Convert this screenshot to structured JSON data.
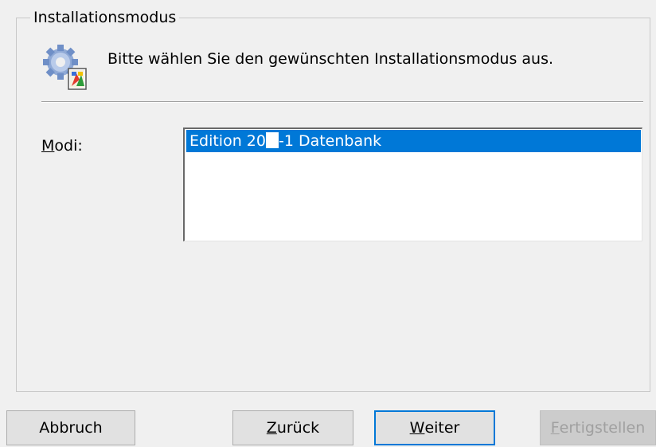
{
  "group": {
    "title": "Installationsmodus"
  },
  "header": {
    "icon": "setup-gear-icon",
    "text": "Bitte wählen Sie den gewünschten Installationsmodus aus."
  },
  "modi": {
    "label_accel": "M",
    "label_rest": "odi:",
    "items": [
      {
        "text_before": "Edition 20",
        "text_after": "-1 Datenbank",
        "selected": true
      }
    ]
  },
  "buttons": {
    "cancel": {
      "label": "Abbruch"
    },
    "back": {
      "accel": "Z",
      "rest": "urück"
    },
    "next": {
      "accel": "W",
      "rest": "eiter"
    },
    "finish": {
      "accel": "F",
      "rest": "ertigstellen",
      "enabled": false
    }
  },
  "colors": {
    "selection": "#0078d7",
    "background": "#f0f0f0",
    "default_button_border": "#0078d7"
  }
}
